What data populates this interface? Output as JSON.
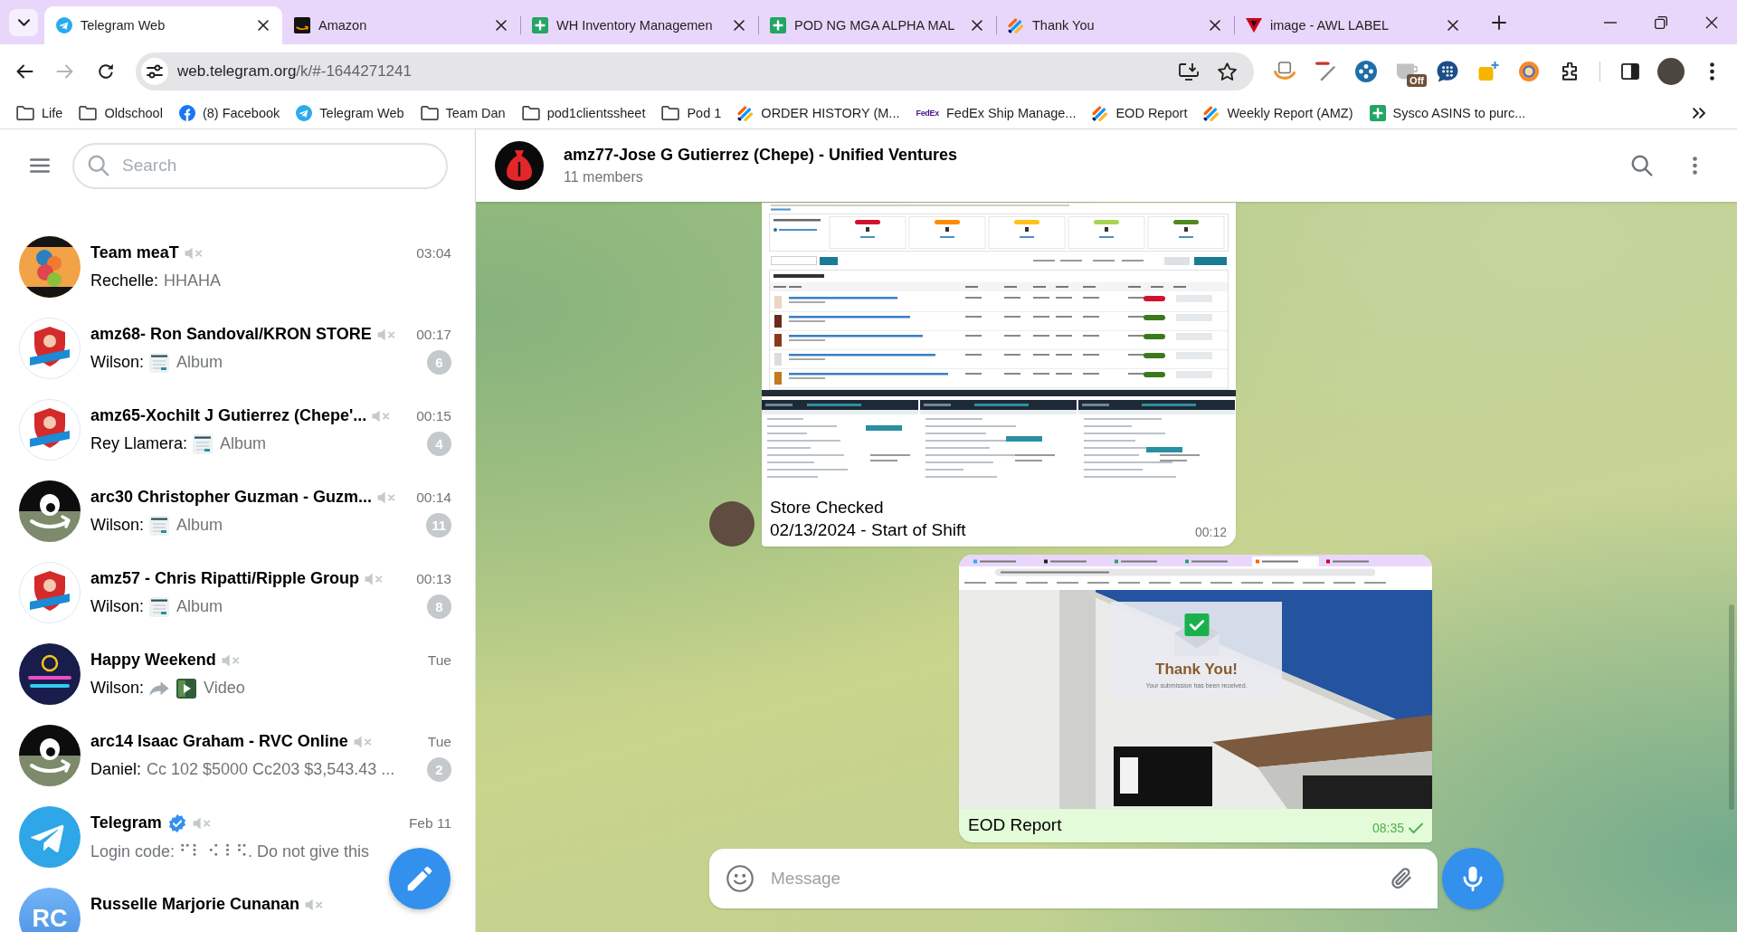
{
  "browser": {
    "tabs": [
      {
        "title": "Telegram Web",
        "kind": "plane",
        "selected": true
      },
      {
        "title": "Amazon",
        "kind": "smile",
        "selected": false
      },
      {
        "title": "WH Inventory Managemen",
        "kind": "sheet",
        "selected": false
      },
      {
        "title": "POD NG MGA ALPHA MAL",
        "kind": "sheet",
        "selected": false
      },
      {
        "title": "Thank You",
        "kind": "stripes",
        "selected": false
      },
      {
        "title": "image - AWL LABEL",
        "kind": "triangle",
        "selected": false
      }
    ],
    "nav": {
      "back_disabled": false,
      "forward_disabled": true
    },
    "address": {
      "host": "web.telegram.org",
      "path": "/k/#-1644271241"
    },
    "extensions": [
      {
        "kind": "swoosh"
      },
      {
        "kind": "pen"
      },
      {
        "kind": "dots"
      },
      {
        "kind": "cup",
        "badge": "Off"
      },
      {
        "kind": "bubble"
      },
      {
        "kind": "tile"
      },
      {
        "kind": "orb"
      }
    ],
    "bookmarks": [
      {
        "label": "Life",
        "kind": "folder"
      },
      {
        "label": "Oldschool",
        "kind": "folder"
      },
      {
        "label": "(8) Facebook",
        "kind": "f"
      },
      {
        "label": "Telegram Web",
        "kind": "plane"
      },
      {
        "label": "Team Dan",
        "kind": "folder"
      },
      {
        "label": "pod1clientssheet",
        "kind": "folder"
      },
      {
        "label": "Pod 1",
        "kind": "folder"
      },
      {
        "label": "ORDER HISTORY (M...",
        "kind": "stripes"
      },
      {
        "label": "FedEx Ship Manage...",
        "kind": "wordmark",
        "icon_text": "FedEx"
      },
      {
        "label": "EOD Report",
        "kind": "stripes"
      },
      {
        "label": "Weekly Report (AMZ)",
        "kind": "stripes"
      },
      {
        "label": "Sysco ASINS to purc...",
        "kind": "sheet"
      }
    ]
  },
  "sidebar": {
    "search": {
      "placeholder": "Search"
    },
    "chats": [
      {
        "name": "Team meaT",
        "avatar": {
          "kind": "letters"
        },
        "verified": false,
        "muted": true,
        "time": "03:04",
        "sender": "Rechelle:",
        "forwarded": false,
        "preview": "HHAHA"
      },
      {
        "name": "amz68- Ron Sandoval/KRON STORE",
        "avatar": {
          "kind": "shield"
        },
        "verified": false,
        "muted": true,
        "time": "00:17",
        "sender": "Wilson:",
        "forwarded": false,
        "media": {
          "kind": "photo"
        },
        "preview": "Album",
        "unread": "6"
      },
      {
        "name": "amz65-Xochilt J Gutierrez (Chepe'...",
        "avatar": {
          "kind": "shield"
        },
        "verified": false,
        "muted": true,
        "time": "00:15",
        "sender": "Rey Llamera:",
        "forwarded": false,
        "media": {
          "kind": "photo"
        },
        "preview": "Album",
        "unread": "4"
      },
      {
        "name": "arc30 Christopher Guzman - Guzm...",
        "avatar": {
          "kind": "smile"
        },
        "verified": false,
        "muted": true,
        "time": "00:14",
        "sender": "Wilson:",
        "forwarded": false,
        "media": {
          "kind": "photo"
        },
        "preview": "Album",
        "unread": "11"
      },
      {
        "name": "amz57 - Chris Ripatti/Ripple Group",
        "avatar": {
          "kind": "shield"
        },
        "verified": false,
        "muted": true,
        "time": "00:13",
        "sender": "Wilson:",
        "forwarded": false,
        "media": {
          "kind": "photo"
        },
        "preview": "Album",
        "unread": "8"
      },
      {
        "name": "Happy Weekend",
        "avatar": {
          "kind": "neon"
        },
        "verified": false,
        "muted": true,
        "time": "Tue",
        "sender": "Wilson:",
        "forwarded": true,
        "media": {
          "kind": "video"
        },
        "preview": "Video"
      },
      {
        "name": "arc14 Isaac Graham - RVC Online",
        "avatar": {
          "kind": "smile"
        },
        "verified": false,
        "muted": true,
        "time": "Tue",
        "sender": "Daniel:",
        "forwarded": false,
        "preview": "Cc 102 $5000 Cc203 $3,543.43 ...",
        "unread": "2"
      },
      {
        "name": "Telegram",
        "avatar": {
          "kind": "plane"
        },
        "verified": true,
        "muted": true,
        "time": "Feb 11",
        "forwarded": false,
        "preview": "Login code: ⠋⠇ ⠪ ⠇⠫. Do not give this"
      },
      {
        "name": "Russelle Marjorie Cunanan",
        "avatar": {
          "kind": "initials",
          "text": "RC"
        },
        "verified": false,
        "muted": true,
        "forwarded": false
      }
    ]
  },
  "chat": {
    "avatar": {
      "kind": "moneybag"
    },
    "title": "amz77-Jose G Gutierrez (Chepe) - Unified Ventures",
    "subtitle": "11 members",
    "messages": [
      {
        "kind": "album",
        "outgoing": false,
        "avatar": {
          "kind": "photo"
        },
        "caption": "Store Checked\n02/13/2024 - Start of Shift",
        "time": "00:12"
      },
      {
        "kind": "photo",
        "outgoing": true,
        "card_title": "Thank You!",
        "card_text": "Your submission has been received.",
        "caption": "EOD Report",
        "time": "08:35",
        "read": false
      }
    ],
    "composer": {
      "placeholder": "Message"
    }
  }
}
